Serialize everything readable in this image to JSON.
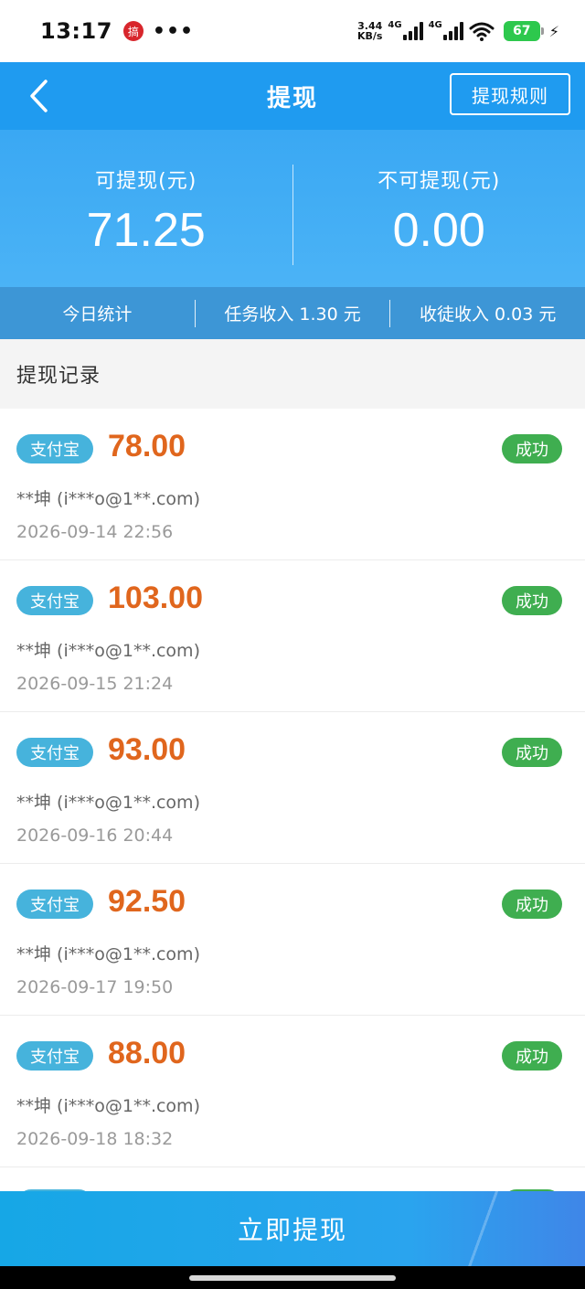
{
  "status_bar": {
    "time": "13:17",
    "app_icon_glyph": "搞",
    "dots": "•••",
    "speed_value": "3.44",
    "speed_unit": "KB/s",
    "net1": "4G",
    "net2": "4G",
    "battery": "67"
  },
  "nav": {
    "title": "提现",
    "rules_label": "提现规则"
  },
  "balance": {
    "available_label": "可提现(元)",
    "available_value": "71.25",
    "unavailable_label": "不可提现(元)",
    "unavailable_value": "0.00"
  },
  "stats": {
    "today_label": "今日统计",
    "task_income": "任务收入 1.30 元",
    "apprentice_income": "收徒收入 0.03 元"
  },
  "records_title": "提现记录",
  "records": [
    {
      "method": "支付宝",
      "amount": "78.00",
      "status": "成功",
      "account": "**坤 (i***o@1**.com)",
      "date": "2026-09-14 22:56"
    },
    {
      "method": "支付宝",
      "amount": "103.00",
      "status": "成功",
      "account": "**坤 (i***o@1**.com)",
      "date": "2026-09-15 21:24"
    },
    {
      "method": "支付宝",
      "amount": "93.00",
      "status": "成功",
      "account": "**坤 (i***o@1**.com)",
      "date": "2026-09-16 20:44"
    },
    {
      "method": "支付宝",
      "amount": "92.50",
      "status": "成功",
      "account": "**坤 (i***o@1**.com)",
      "date": "2026-09-17 19:50"
    },
    {
      "method": "支付宝",
      "amount": "88.00",
      "status": "成功",
      "account": "**坤 (i***o@1**.com)",
      "date": "2026-09-18 18:32"
    }
  ],
  "action": {
    "withdraw_label": "立即提现"
  },
  "colors": {
    "primary": "#1f9bf0",
    "amount": "#e0661d",
    "success": "#3fae50",
    "badge": "#46b3dc"
  }
}
